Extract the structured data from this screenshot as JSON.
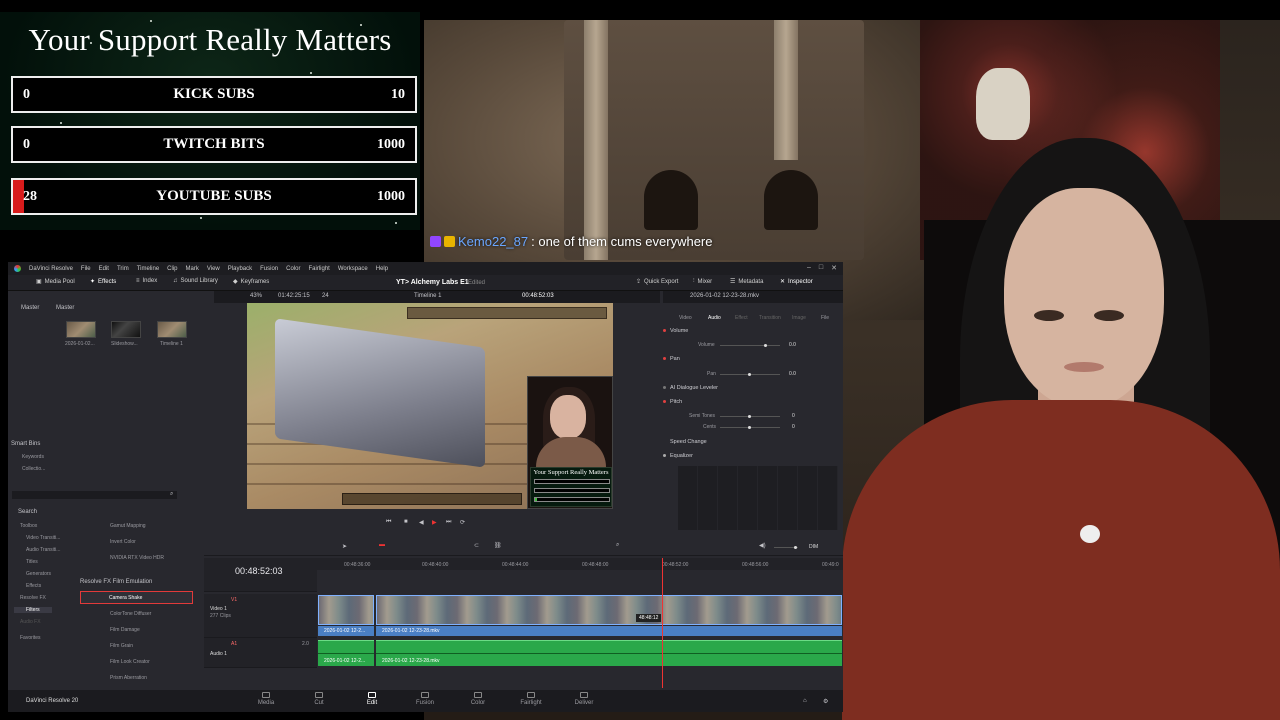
{
  "goals": {
    "title": "Your Support Really Matters",
    "items": [
      {
        "current": "0",
        "label": "KICK SUBS",
        "target": "10",
        "progress": 0
      },
      {
        "current": "0",
        "label": "TWITCH BITS",
        "target": "1000",
        "progress": 0
      },
      {
        "current": "28",
        "label": "YOUTUBE SUBS",
        "target": "1000",
        "progress": 0.028
      }
    ],
    "colors": {
      "fill": "#d81c1c",
      "background": "#02100a"
    }
  },
  "chat": {
    "username": "Kemo22_87",
    "message": ": one of them cums everywhere",
    "badges": [
      "twitch-icon",
      "crown-icon"
    ],
    "username_color": "#6aa6ff"
  },
  "resolve": {
    "menu": [
      "DaVinci Resolve",
      "File",
      "Edit",
      "Trim",
      "Timeline",
      "Clip",
      "Mark",
      "View",
      "Playback",
      "Fusion",
      "Color",
      "Fairlight",
      "Workspace",
      "Help"
    ],
    "toolbar_left": [
      "Media Pool",
      "Effects",
      "Index",
      "Sound Library",
      "Keyframes"
    ],
    "project": "YT> Alchemy Labs E1",
    "edited": "Edited",
    "toolbar_right": [
      "Quick Export",
      "Mixer",
      "Metadata",
      "Inspector"
    ],
    "viewer": {
      "zoom": "43%",
      "source_tc": "01:42:25:15",
      "fps": "24",
      "timeline_name": "Timeline 1",
      "record_tc": "00:48:52:03",
      "clip_name": "2026-01-02 12-23-28.mkv"
    },
    "media_pool": {
      "tabs": [
        "Master",
        "Master"
      ],
      "clips": [
        "2026-01-02...",
        "Slideshow...",
        "Timeline 1"
      ],
      "smart_bins_title": "Smart Bins",
      "smart_bins": [
        "Keywords",
        "Collectio..."
      ]
    },
    "effects": {
      "search_label": "Search",
      "tree": [
        "Toolbox",
        "Video Transiti...",
        "Audio Transiti...",
        "Titles",
        "Generators",
        "Effects",
        "Resolve FX",
        "Filters",
        "Audio FX",
        "Favorites"
      ],
      "list_top": [
        "Gamut Mapping",
        "Invert Color",
        "NVIDIA RTX Video HDR"
      ],
      "section": "Resolve FX Film Emulation",
      "list": [
        "Camera Shake",
        "ColorTone Diffuser",
        "Film Damage",
        "Film Grain",
        "Film Look Creator",
        "Prism Aberration"
      ]
    },
    "inspector": {
      "tabs": [
        "Video",
        "Audio",
        "Effect",
        "Transition",
        "Image",
        "File"
      ],
      "active_tab": "Audio",
      "volume": {
        "title": "Volume",
        "label": "Volume",
        "value": "0.0"
      },
      "pan": {
        "title": "Pan",
        "label": "Pan",
        "value": "0.0"
      },
      "ai_leveler": "AI Dialogue Leveler",
      "pitch": {
        "title": "Pitch",
        "semitones_label": "Semi Tones",
        "semitones": "0",
        "cents_label": "Cents",
        "cents": "0"
      },
      "speed_change": "Speed Change",
      "equalizer": "Equalizer"
    },
    "timeline": {
      "timecode": "00:48:52:03",
      "ruler": [
        "00:48:36:00",
        "00:48:40:00",
        "00:48:44:00",
        "00:48:48:00",
        "00:48:52:00",
        "00:48:56:00",
        "00:49:0"
      ],
      "video_track": {
        "id": "V1",
        "name": "Video 1",
        "clips": "277 Clips"
      },
      "audio_track": {
        "id": "A1",
        "name": "Audio 1",
        "level": "2.0"
      },
      "video_clip_names": [
        "2026-01-02 12-2...",
        "2026-01-02 12-23-28.mkv"
      ],
      "audio_clip_names": [
        "2026-01-02 12-2...",
        "2026-01-02 12-23-28.mkv"
      ],
      "hover_tc": "48:48:12",
      "dim_label": "DIM"
    },
    "app_name": "DaVinci Resolve 20",
    "page_tabs": [
      "Media",
      "Cut",
      "Edit",
      "Fusion",
      "Color",
      "Fairlight",
      "Deliver"
    ],
    "active_page": "Edit",
    "colors": {
      "accent": "#e33333",
      "video_clip_border": "#7fb1ff",
      "audio_clip": "#2aa84a",
      "panel": "#28282e"
    }
  }
}
